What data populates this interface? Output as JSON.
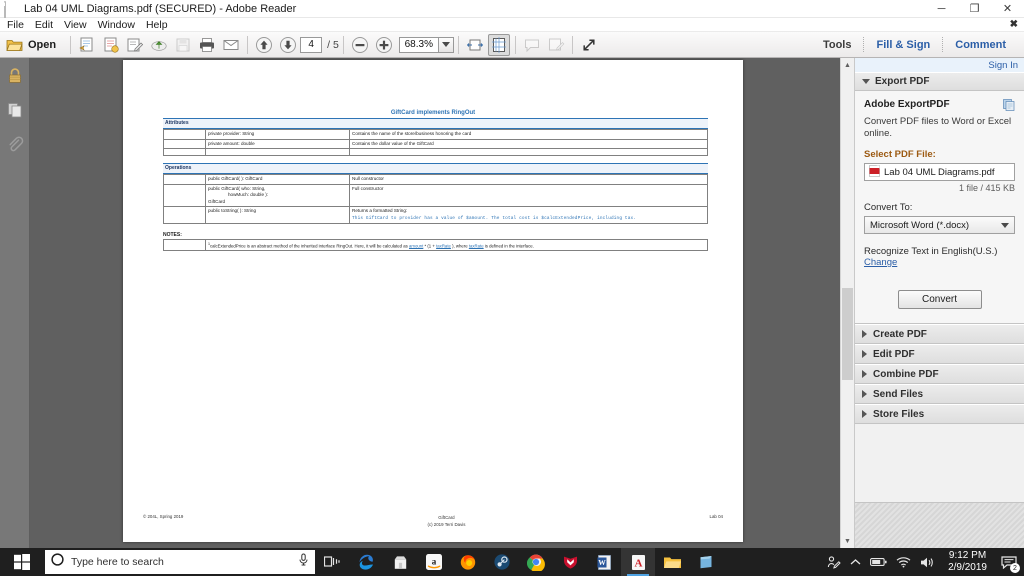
{
  "window": {
    "title": "Lab 04 UML Diagrams.pdf (SECURED) - Adobe Reader",
    "app_icon": "pdf-file-icon",
    "minimize": "─",
    "maximize": "❐",
    "close": "✕",
    "menubar_close": "✖"
  },
  "menu": {
    "items": [
      {
        "label": "File"
      },
      {
        "label": "Edit"
      },
      {
        "label": "View"
      },
      {
        "label": "Window"
      },
      {
        "label": "Help"
      }
    ]
  },
  "toolbar": {
    "open_label": "Open",
    "page_current": "4",
    "page_total": "/ 5",
    "zoom_value": "68.3%",
    "tools_label": "Tools",
    "fill_sign_label": "Fill & Sign",
    "comment_label": "Comment",
    "icons": [
      "open-folder-icon",
      "save-as-copy-icon",
      "create-pdf-icon",
      "sign-icon",
      "upload-cloud-icon",
      "save-icon",
      "print-icon",
      "email-icon",
      "previous-page-icon",
      "next-page-icon",
      "zoom-out-icon",
      "zoom-in-icon",
      "fit-width-icon",
      "fit-page-icon",
      "sticky-note-icon",
      "highlight-icon",
      "fullscreen-icon"
    ]
  },
  "left_rail": {
    "items": [
      {
        "icon": "lock-icon",
        "name": "security-panel"
      },
      {
        "icon": "pages-icon",
        "name": "page-thumbnails-panel"
      },
      {
        "icon": "paperclip-icon",
        "name": "attachments-panel"
      }
    ]
  },
  "document": {
    "title": "GiftCard implements RingOut",
    "sections": {
      "attributes_label": "Attributes",
      "operations_label": "Operations",
      "notes_label": "NOTES:"
    },
    "attributes": [
      {
        "visibility": "",
        "signature": "private provider: String",
        "description": "Contains the name of the store/business honoring the card"
      },
      {
        "visibility": "",
        "signature": "private amount: double",
        "description": "Contains the dollar value of the GiftCard"
      },
      {
        "visibility": "",
        "signature": "",
        "description": ""
      }
    ],
    "operations": [
      {
        "visibility": "",
        "signature": "public GiftCard( ): GiftCard",
        "signature_line2": "",
        "signature_line3": "",
        "description": "Null constructor",
        "description_code": ""
      },
      {
        "visibility": "",
        "signature": "public GiftCard( who: String,",
        "signature_line2": "howMuch: double ):",
        "signature_line3": "GiftCard",
        "description": "Full constructor",
        "description_code": ""
      },
      {
        "visibility": "",
        "signature": "public toString( ): String",
        "signature_line2": "",
        "signature_line3": "",
        "description": "Returns a formatted String:",
        "description_code": "This GiftCard to provider has a value of $amount. The total cost is $calcExtendedPrice, including tax."
      }
    ],
    "note": {
      "prefix": "calcExtendedPrice is an abstract method of the inherited interface RingOut.  Here, it will be calculated as ",
      "link1": "amount",
      "mid": " * (1 + ",
      "link2": "taxRate",
      "mid2": " ), where ",
      "link3": "taxRate",
      "suffix": " is defined in the interface."
    },
    "footer": {
      "left": "© 204L, Spring 2019",
      "center_line1": "GiftCard",
      "center_line2": "(c) 2019 Terri Davis",
      "right": "Lab 04"
    }
  },
  "right_panel": {
    "sign_in": "Sign In",
    "export_header": "Export PDF",
    "adobe_export_title": "Adobe ExportPDF",
    "adobe_export_desc": "Convert PDF files to Word or Excel online.",
    "select_pdf_label": "Select PDF File:",
    "selected_file": "Lab 04 UML Diagrams.pdf",
    "file_meta": "1 file / 415 KB",
    "convert_to_label": "Convert To:",
    "convert_to_value": "Microsoft Word (*.docx)",
    "recognize_text": "Recognize Text in English(U.S.)",
    "change_link": "Change",
    "convert_button": "Convert",
    "accordions": [
      {
        "label": "Create PDF"
      },
      {
        "label": "Edit PDF"
      },
      {
        "label": "Combine PDF"
      },
      {
        "label": "Send Files"
      },
      {
        "label": "Store Files"
      }
    ]
  },
  "taskbar": {
    "search_placeholder": "Type here to search",
    "time": "9:12 PM",
    "date": "2/9/2019",
    "notification_count": "2",
    "apps": [
      {
        "name": "task-view-icon"
      },
      {
        "name": "edge-icon"
      },
      {
        "name": "microsoft-store-icon"
      },
      {
        "name": "amazon-icon"
      },
      {
        "name": "firefox-icon"
      },
      {
        "name": "steam-icon"
      },
      {
        "name": "chrome-icon"
      },
      {
        "name": "mcafee-icon"
      },
      {
        "name": "word-icon"
      },
      {
        "name": "adobe-reader-icon"
      },
      {
        "name": "file-explorer-icon"
      },
      {
        "name": "sticky-notes-icon"
      }
    ],
    "tray": [
      {
        "name": "pen-people-icon"
      },
      {
        "name": "show-hidden-icons-icon"
      },
      {
        "name": "battery-icon"
      },
      {
        "name": "wifi-icon"
      },
      {
        "name": "volume-icon"
      }
    ]
  }
}
